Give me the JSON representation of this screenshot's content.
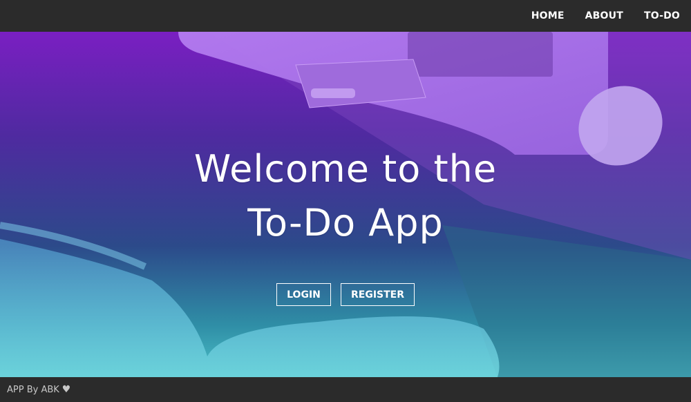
{
  "nav": {
    "links": [
      "HOME",
      "ABOUT",
      "TO-DO"
    ]
  },
  "hero": {
    "title_line1": "Welcome to the",
    "title_line2": "To-Do App",
    "login_label": "LOGIN",
    "register_label": "REGISTER"
  },
  "footer": {
    "text": "APP By ABK",
    "icon": "heart-icon"
  },
  "colors": {
    "nav_bg": "#2b2b2b",
    "gradient_top": "#7a1fc2",
    "gradient_bottom": "#4cc0c8",
    "text": "#ffffff"
  }
}
